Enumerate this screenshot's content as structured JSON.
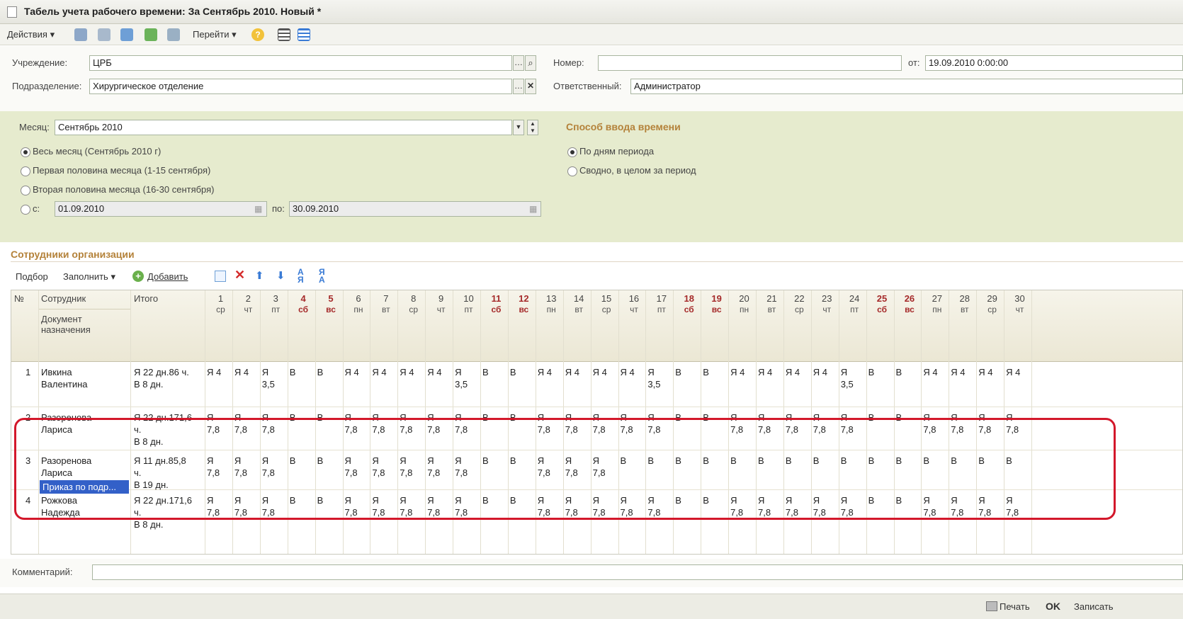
{
  "window": {
    "title": "Табель учета рабочего времени: За Сентябрь 2010. Новый *"
  },
  "toolbar": {
    "actions": "Действия",
    "goto": "Перейти"
  },
  "header": {
    "institution_label": "Учреждение:",
    "institution": "ЦРБ",
    "number_label": "Номер:",
    "number": "",
    "date_label": "от:",
    "date": "19.09.2010 0:00:00",
    "department_label": "Подразделение:",
    "department": "Хирургическое отделение",
    "responsible_label": "Ответственный:",
    "responsible": "Администратор"
  },
  "period": {
    "month_label": "Месяц:",
    "month": "Сентябрь 2010",
    "options": [
      "Весь месяц (Сентябрь 2010 г)",
      "Первая половина месяца (1-15 сентября)",
      "Вторая половина месяца (16-30 сентября)"
    ],
    "from_label": "с:",
    "from": "01.09.2010",
    "to_label": "по:",
    "to": "30.09.2010"
  },
  "input_mode": {
    "title": "Способ ввода времени",
    "options": [
      "По дням периода",
      "Сводно, в целом за период"
    ]
  },
  "employees": {
    "section_title": "Сотрудники организации",
    "toolbar": {
      "select": "Подбор",
      "fill": "Заполнить",
      "add": "Добавить"
    },
    "columns": {
      "no": "№",
      "employee": "Сотрудник",
      "document": "Документ назначения",
      "total": "Итого"
    },
    "days": [
      {
        "d": "1",
        "w": "ср",
        "we": false
      },
      {
        "d": "2",
        "w": "чт",
        "we": false
      },
      {
        "d": "3",
        "w": "пт",
        "we": false
      },
      {
        "d": "4",
        "w": "сб",
        "we": true
      },
      {
        "d": "5",
        "w": "вс",
        "we": true
      },
      {
        "d": "6",
        "w": "пн",
        "we": false
      },
      {
        "d": "7",
        "w": "вт",
        "we": false
      },
      {
        "d": "8",
        "w": "ср",
        "we": false
      },
      {
        "d": "9",
        "w": "чт",
        "we": false
      },
      {
        "d": "10",
        "w": "пт",
        "we": false
      },
      {
        "d": "11",
        "w": "сб",
        "we": true
      },
      {
        "d": "12",
        "w": "вс",
        "we": true
      },
      {
        "d": "13",
        "w": "пн",
        "we": false
      },
      {
        "d": "14",
        "w": "вт",
        "we": false
      },
      {
        "d": "15",
        "w": "ср",
        "we": false
      },
      {
        "d": "16",
        "w": "чт",
        "we": false
      },
      {
        "d": "17",
        "w": "пт",
        "we": false
      },
      {
        "d": "18",
        "w": "сб",
        "we": true
      },
      {
        "d": "19",
        "w": "вс",
        "we": true
      },
      {
        "d": "20",
        "w": "пн",
        "we": false
      },
      {
        "d": "21",
        "w": "вт",
        "we": false
      },
      {
        "d": "22",
        "w": "ср",
        "we": false
      },
      {
        "d": "23",
        "w": "чт",
        "we": false
      },
      {
        "d": "24",
        "w": "пт",
        "we": false
      },
      {
        "d": "25",
        "w": "сб",
        "we": true
      },
      {
        "d": "26",
        "w": "вс",
        "we": true
      },
      {
        "d": "27",
        "w": "пн",
        "we": false
      },
      {
        "d": "28",
        "w": "вт",
        "we": false
      },
      {
        "d": "29",
        "w": "ср",
        "we": false
      },
      {
        "d": "30",
        "w": "чт",
        "we": false
      }
    ],
    "rows": [
      {
        "no": "1",
        "name": "Ивкина\nВалентина",
        "doc": "",
        "total": "Я 22 дн.86 ч.\nВ 8 дн.",
        "cells": [
          "Я 4",
          "Я 4",
          "Я\n3,5",
          "В",
          "В",
          "Я 4",
          "Я 4",
          "Я 4",
          "Я 4",
          "Я\n3,5",
          "В",
          "В",
          "Я 4",
          "Я 4",
          "Я 4",
          "Я 4",
          "Я\n3,5",
          "В",
          "В",
          "Я 4",
          "Я 4",
          "Я 4",
          "Я 4",
          "Я\n3,5",
          "В",
          "В",
          "Я 4",
          "Я 4",
          "Я 4",
          "Я 4"
        ]
      },
      {
        "no": "2",
        "name": "Разоренова\nЛариса",
        "doc": "",
        "total": "Я 22 дн.171,6\nч.\nВ 8 дн.",
        "cells": [
          "Я\n7,8",
          "Я\n7,8",
          "Я\n7,8",
          "В",
          "В",
          "Я\n7,8",
          "Я\n7,8",
          "Я\n7,8",
          "Я\n7,8",
          "Я\n7,8",
          "В",
          "В",
          "Я\n7,8",
          "Я\n7,8",
          "Я\n7,8",
          "Я\n7,8",
          "Я\n7,8",
          "В",
          "В",
          "Я\n7,8",
          "Я\n7,8",
          "Я\n7,8",
          "Я\n7,8",
          "Я\n7,8",
          "В",
          "В",
          "Я\n7,8",
          "Я\n7,8",
          "Я\n7,8",
          "Я\n7,8"
        ]
      },
      {
        "no": "3",
        "name": "Разоренова\nЛариса",
        "doc": "Приказ по подр...",
        "total": "Я 11 дн.85,8\nч.\nВ 19 дн.",
        "cells": [
          "Я\n7,8",
          "Я\n7,8",
          "Я\n7,8",
          "В",
          "В",
          "Я\n7,8",
          "Я\n7,8",
          "Я\n7,8",
          "Я\n7,8",
          "Я\n7,8",
          "В",
          "В",
          "Я\n7,8",
          "Я\n7,8",
          "Я\n7,8",
          "В",
          "В",
          "В",
          "В",
          "В",
          "В",
          "В",
          "В",
          "В",
          "В",
          "В",
          "В",
          "В",
          "В",
          "В"
        ]
      },
      {
        "no": "4",
        "name": "Рожкова\nНадежда",
        "doc": "",
        "total": "Я 22 дн.171,6\nч.\nВ 8 дн.",
        "cells": [
          "Я\n7,8",
          "Я\n7,8",
          "Я\n7,8",
          "В",
          "В",
          "Я\n7,8",
          "Я\n7,8",
          "Я\n7,8",
          "Я\n7,8",
          "Я\n7,8",
          "В",
          "В",
          "Я\n7,8",
          "Я\n7,8",
          "Я\n7,8",
          "Я\n7,8",
          "Я\n7,8",
          "В",
          "В",
          "Я\n7,8",
          "Я\n7,8",
          "Я\n7,8",
          "Я\n7,8",
          "Я\n7,8",
          "В",
          "В",
          "Я\n7,8",
          "Я\n7,8",
          "Я\n7,8",
          "Я\n7,8"
        ]
      }
    ]
  },
  "comment": {
    "label": "Комментарий:",
    "value": ""
  },
  "footer": {
    "print": "Печать",
    "ok": "OK",
    "save": "Записать"
  }
}
